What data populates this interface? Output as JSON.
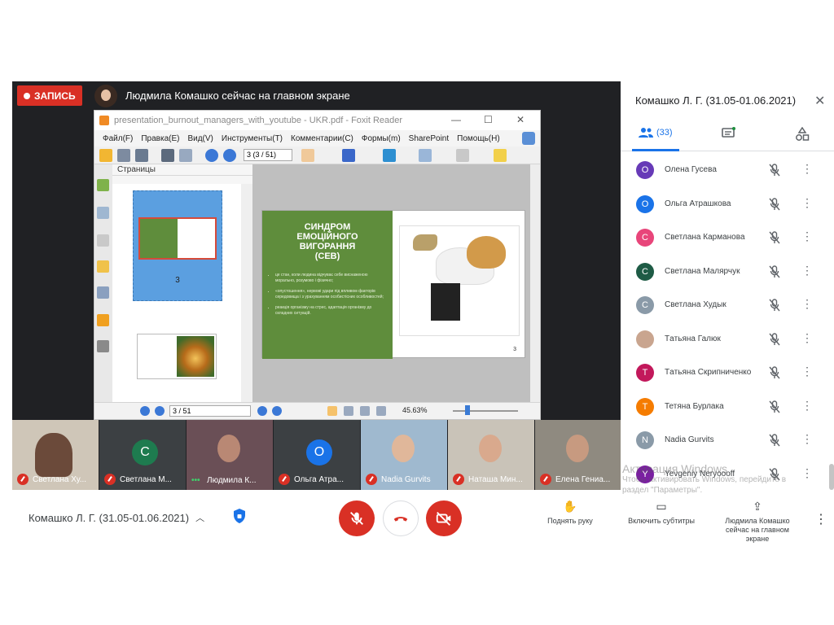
{
  "recording": {
    "label": "ЗАПИСЬ"
  },
  "presenter": {
    "banner": "Людмила Комашко сейчас на главном экране"
  },
  "foxit": {
    "title": "presentation_burnout_managers_with_youtube - UKR.pdf - Foxit Reader",
    "menu": [
      "Файл(F)",
      "Правка(E)",
      "Вид(V)",
      "Инструменты(T)",
      "Комментарии(C)",
      "Формы(m)",
      "SharePoint",
      "Помощь(H)"
    ],
    "toolbar_page": "3 (3 / 51)",
    "pages_panel": "Страницы",
    "thumb_page": "3",
    "status_page": "3 / 51",
    "zoom": "45.63%"
  },
  "slide": {
    "title_lines": [
      "СИНДРОМ",
      "ЕМОЦІЙНОГО",
      "ВИГОРАННЯ",
      "(СЕВ)"
    ],
    "bullets": [
      "це стан, коли людина відчуває себе виснаженою морально, розумово і фізично;",
      "«опустошення», нервові удари під впливом факторів середовища і з урахуванням особистісних особливостей;",
      "реакція організму на стрес, адаптація організму до складних ситуацій."
    ],
    "page": "3"
  },
  "film": [
    {
      "name": "Светлана Ху...",
      "bg": "#cfc6b8",
      "status": "muted"
    },
    {
      "name": "Светлана М...",
      "bg": "#3c4043",
      "status": "muted",
      "initial": "С",
      "color": "#1e7b4f"
    },
    {
      "name": "Людмила К...",
      "bg": "#6a4f56",
      "status": "speaking"
    },
    {
      "name": "Ольга Атра...",
      "bg": "#3c4043",
      "status": "muted",
      "initial": "О",
      "color": "#1a73e8"
    },
    {
      "name": "Nadia Gurvits",
      "bg": "#9fb9cf",
      "status": "muted"
    },
    {
      "name": "Наташа Мин...",
      "bg": "#c9c3b8",
      "status": "muted"
    },
    {
      "name": "Елена Гениа...",
      "bg": "#8f8a80",
      "status": "muted"
    }
  ],
  "bottom": {
    "meeting": "Комашко Л. Г. (31.05-01.06.2021)",
    "raise_hand": "Поднять руку",
    "captions": "Включить субтитры",
    "presenting": [
      "Людмила Комашко",
      "сейчас на главном",
      "экране"
    ]
  },
  "panel": {
    "title": "Комашко Л. Г. (31.05-01.06.2021)",
    "people_count": "(33)",
    "participants": [
      {
        "initial": "О",
        "name": "Олена Гусева",
        "color": "#673ab7"
      },
      {
        "initial": "О",
        "name": "Ольга Атрашкова",
        "color": "#1a73e8"
      },
      {
        "initial": "С",
        "name": "Светлана Карманова",
        "color": "#e8457a"
      },
      {
        "initial": "С",
        "name": "Светлана Малярчук",
        "color": "#1e5b45"
      },
      {
        "initial": "С",
        "name": "Светлана Худык",
        "color": "#8a9aa8"
      },
      {
        "initial": "",
        "name": "Тaтьяна Галюк",
        "color": "#c9a58f"
      },
      {
        "initial": "Т",
        "name": "Тaтьяна Скрипниченко",
        "color": "#c2185b"
      },
      {
        "initial": "Т",
        "name": "Тетяна Бурлака",
        "color": "#f57c00"
      },
      {
        "initial": "N",
        "name": "Nadia Gurvits",
        "color": "#8a9aa8"
      },
      {
        "initial": "Y",
        "name": "Yevgeniy Neryoooff",
        "color": "#7b1fa2"
      }
    ]
  },
  "watermark": {
    "line1": "Активация Windows",
    "line2": "Чтобы активировать Windows, перейдите в",
    "line3": "раздел \"Параметры\"."
  }
}
